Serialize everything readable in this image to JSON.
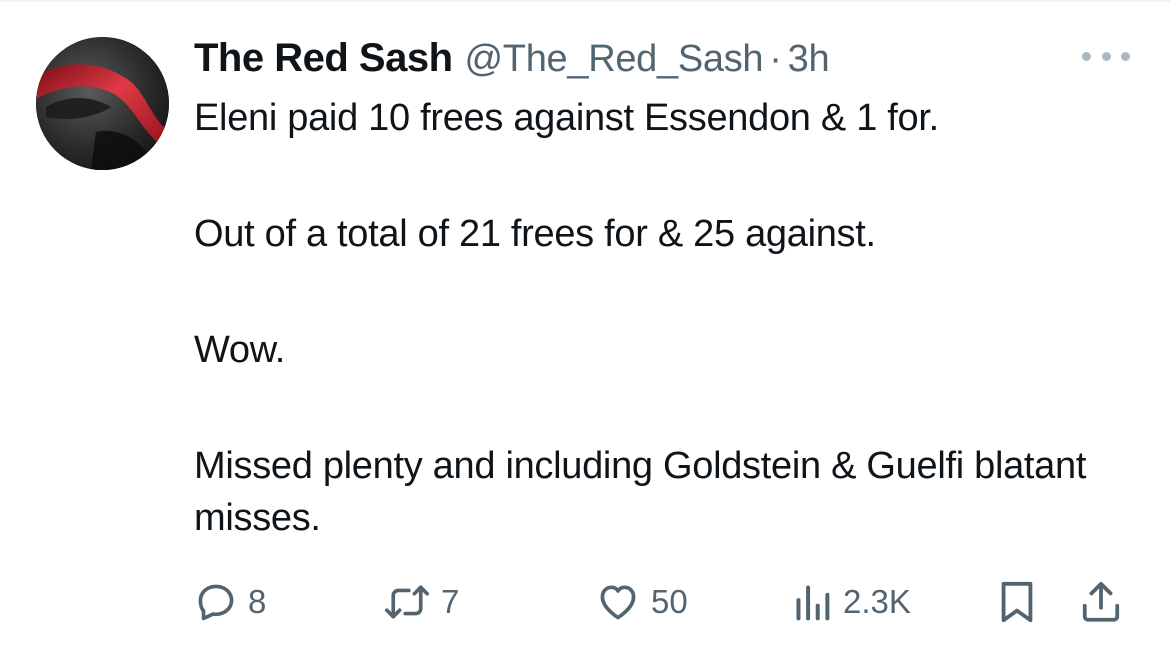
{
  "tweet": {
    "author": {
      "display_name": "The Red Sash",
      "handle": "@The_Red_Sash",
      "separator": "·",
      "time": "3h",
      "avatar_icon": "red-sash-avatar"
    },
    "more_icon": "more-horizontal-icon",
    "paragraphs": [
      "Eleni paid 10 frees against Essendon & 1 for.",
      "Out of a total of 21 frees for & 25 against.",
      "Wow.",
      "Missed plenty and including Goldstein & Guelfi blatant misses."
    ],
    "actions": {
      "replies": "8",
      "retweets": "7",
      "likes": "50",
      "views": "2.3K"
    }
  },
  "colors": {
    "text_primary": "#0f1419",
    "text_secondary": "#536471",
    "sash_red": "#c0202e"
  }
}
